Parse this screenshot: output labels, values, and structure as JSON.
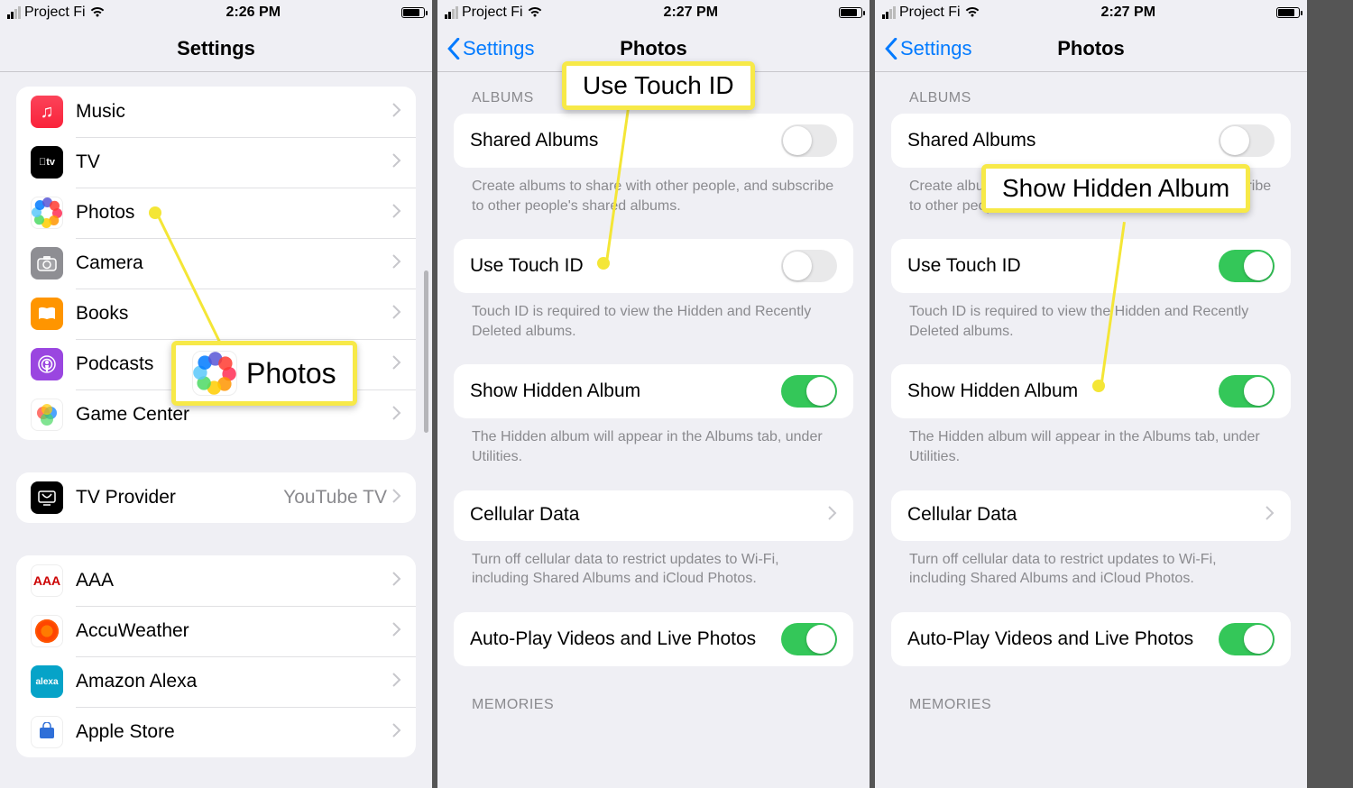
{
  "panel1": {
    "status": {
      "carrier": "Project Fi",
      "time": "2:26 PM"
    },
    "title": "Settings",
    "group1": [
      {
        "id": "music",
        "label": "Music"
      },
      {
        "id": "tv",
        "label": "TV"
      },
      {
        "id": "photos",
        "label": "Photos"
      },
      {
        "id": "camera",
        "label": "Camera"
      },
      {
        "id": "books",
        "label": "Books"
      },
      {
        "id": "podcasts",
        "label": "Podcasts"
      },
      {
        "id": "gamecenter",
        "label": "Game Center"
      }
    ],
    "group2": [
      {
        "id": "tvprovider",
        "label": "TV Provider",
        "value": "YouTube TV"
      }
    ],
    "group3": [
      {
        "id": "aaa",
        "label": "AAA"
      },
      {
        "id": "accu",
        "label": "AccuWeather"
      },
      {
        "id": "alexa",
        "label": "Amazon Alexa"
      },
      {
        "id": "apple",
        "label": "Apple Store"
      }
    ],
    "callout": "Photos"
  },
  "panel2": {
    "status": {
      "carrier": "Project Fi",
      "time": "2:27 PM"
    },
    "back": "Settings",
    "title": "Photos",
    "albums_header": "ALBUMS",
    "shared_albums": "Shared Albums",
    "shared_albums_note": "Create albums to share with other people, and subscribe to other people's shared albums.",
    "touch_id": "Use Touch ID",
    "touch_id_note": "Touch ID is required to view the Hidden and Recently Deleted albums.",
    "show_hidden": "Show Hidden Album",
    "show_hidden_note": "The Hidden album will appear in the Albums tab, under Utilities.",
    "cellular": "Cellular Data",
    "cellular_note": "Turn off cellular data to restrict updates to Wi-Fi, including Shared Albums and iCloud Photos.",
    "autoplay": "Auto-Play Videos and Live Photos",
    "memories_header": "MEMORIES",
    "toggles": {
      "shared": false,
      "touch": false,
      "hidden": true,
      "autoplay": true
    },
    "callout": "Use Touch ID"
  },
  "panel3": {
    "status": {
      "carrier": "Project Fi",
      "time": "2:27 PM"
    },
    "back": "Settings",
    "title": "Photos",
    "toggles": {
      "shared": false,
      "touch": true,
      "hidden": true,
      "autoplay": true
    },
    "callout": "Show Hidden Album"
  }
}
